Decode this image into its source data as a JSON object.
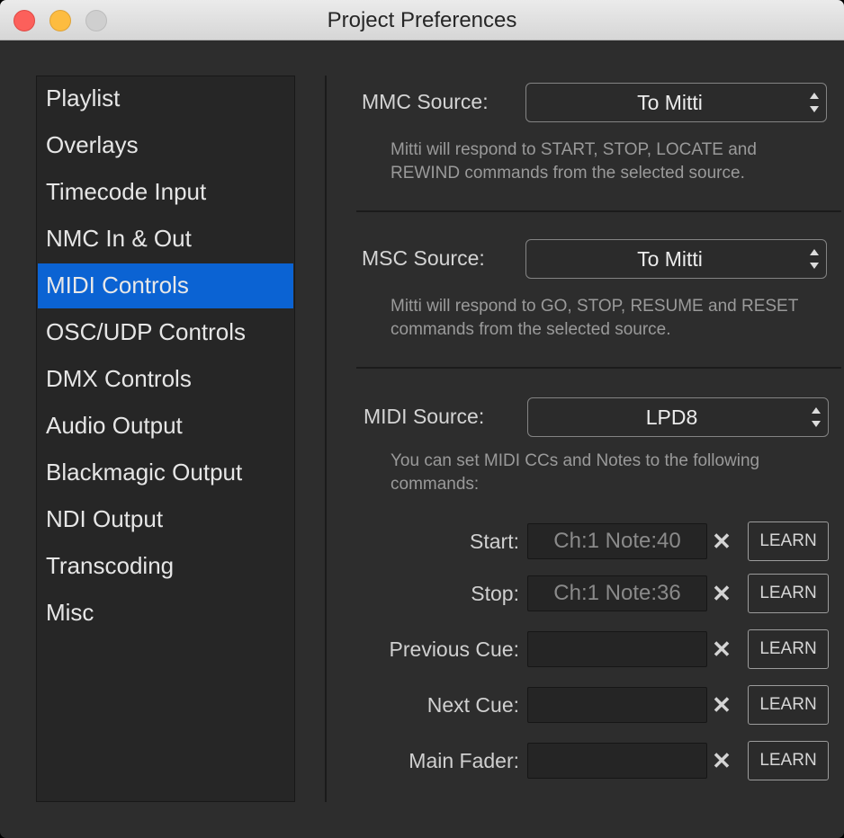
{
  "window": {
    "title": "Project Preferences"
  },
  "sidebar": {
    "selected": "MIDI Controls",
    "items": [
      {
        "label": "Playlist"
      },
      {
        "label": "Overlays"
      },
      {
        "label": "Timecode Input"
      },
      {
        "label": "NMC In & Out"
      },
      {
        "label": "MIDI Controls"
      },
      {
        "label": "OSC/UDP Controls"
      },
      {
        "label": "DMX Controls"
      },
      {
        "label": "Audio Output"
      },
      {
        "label": "Blackmagic Output"
      },
      {
        "label": "NDI Output"
      },
      {
        "label": "Transcoding"
      },
      {
        "label": "Misc"
      }
    ]
  },
  "mmc": {
    "label": "MMC Source:",
    "value": "To Mitti",
    "description": "Mitti will respond to START, STOP, LOCATE and REWIND commands from the selected source."
  },
  "msc": {
    "label": "MSC Source:",
    "value": "To Mitti",
    "description": "Mitti will respond to GO, STOP, RESUME and RESET commands from the selected source."
  },
  "midi": {
    "label": "MIDI Source:",
    "value": "LPD8",
    "description": "You can set MIDI CCs and Notes to the following commands:"
  },
  "controls": [
    {
      "label": "Start:",
      "value": "Ch:1 Note:40",
      "clear": "✕",
      "learn": "LEARN"
    },
    {
      "label": "Stop:",
      "value": "Ch:1 Note:36",
      "clear": "✕",
      "learn": "LEARN"
    },
    {
      "label": "Previous Cue:",
      "value": "",
      "clear": "✕",
      "learn": "LEARN"
    },
    {
      "label": "Next Cue:",
      "value": "",
      "clear": "✕",
      "learn": "LEARN"
    },
    {
      "label": "Main Fader:",
      "value": "",
      "clear": "✕",
      "learn": "LEARN"
    }
  ],
  "colors": {
    "accent": "#0b63d3",
    "background": "#2d2d2d"
  }
}
